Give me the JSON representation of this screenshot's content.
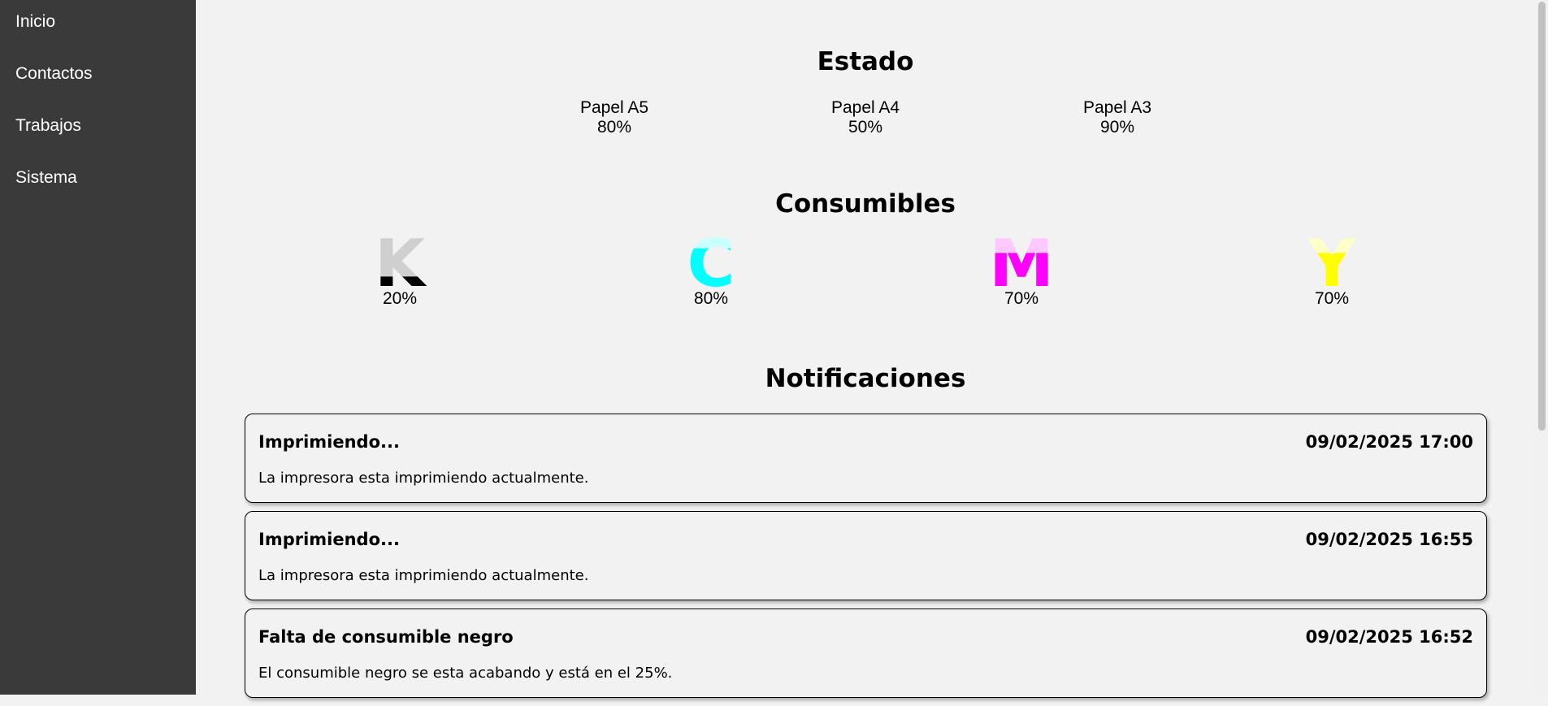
{
  "sidebar": {
    "items": [
      {
        "label": "Inicio"
      },
      {
        "label": "Contactos"
      },
      {
        "label": "Trabajos"
      },
      {
        "label": "Sistema"
      }
    ]
  },
  "estado": {
    "title": "Estado",
    "papers": [
      {
        "label": "Papel A5",
        "value": "80%"
      },
      {
        "label": "Papel A4",
        "value": "50%"
      },
      {
        "label": "Papel A3",
        "value": "90%"
      }
    ]
  },
  "consumibles": {
    "title": "Consumibles",
    "items": [
      {
        "letter": "K",
        "value": "20%",
        "level": 0.2,
        "color": "#000000",
        "empty_color": "#cfcfcf"
      },
      {
        "letter": "C",
        "value": "80%",
        "level": 0.8,
        "color": "#00ffff",
        "empty_color": "#c8ffff"
      },
      {
        "letter": "M",
        "value": "70%",
        "level": 0.7,
        "color": "#ff00ff",
        "empty_color": "#ffc8ff"
      },
      {
        "letter": "Y",
        "value": "70%",
        "level": 0.7,
        "color": "#ffff00",
        "empty_color": "#ffffc8"
      }
    ]
  },
  "notificaciones": {
    "title": "Notificaciones",
    "items": [
      {
        "title": "Imprimiendo...",
        "date": "09/02/2025 17:00",
        "body": "La impresora esta imprimiendo actualmente."
      },
      {
        "title": "Imprimiendo...",
        "date": "09/02/2025 16:55",
        "body": "La impresora esta imprimiendo actualmente."
      },
      {
        "title": "Falta de consumible negro",
        "date": "09/02/2025 16:52",
        "body": "El consumible negro se esta acabando y está en el 25%."
      }
    ]
  }
}
